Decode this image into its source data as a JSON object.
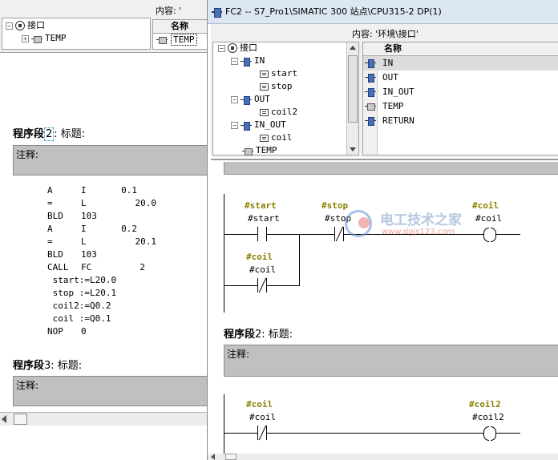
{
  "left_window": {
    "content_label": "内容: '",
    "names_header": "名称",
    "tree": {
      "root": "接口",
      "child": "TEMP"
    },
    "names_rows": [
      "TEMP"
    ],
    "segment2": {
      "label": "程序段",
      "num": "2",
      "suffix": ": 标题:"
    },
    "segment3": {
      "label": "程序段",
      "num": "3",
      "suffix": ": 标题:"
    },
    "comment_label": "注释:",
    "stl_lines": [
      [
        "A",
        "I",
        "0.1"
      ],
      [
        "=",
        "L",
        "20.0"
      ],
      [
        "BLD",
        "103",
        ""
      ],
      [
        "A",
        "I",
        "0.2"
      ],
      [
        "=",
        "L",
        "20.1"
      ],
      [
        "BLD",
        "103",
        ""
      ],
      [
        "CALL",
        "FC",
        "2"
      ],
      [
        " start:=L20.0",
        "",
        ""
      ],
      [
        " stop :=L20.1",
        "",
        ""
      ],
      [
        " coil2:=Q0.2",
        "",
        ""
      ],
      [
        " coil :=Q0.1",
        "",
        ""
      ],
      [
        "NOP",
        "0",
        ""
      ]
    ]
  },
  "right_window": {
    "title": "FC2 -- S7_Pro1\\SIMATIC 300 站点\\CPU315-2 DP(1)",
    "content_label": "内容: '环境\\接口'",
    "names_header": "名称",
    "tree": {
      "root": "接口",
      "in": "IN",
      "in_children": [
        "start",
        "stop"
      ],
      "out": "OUT",
      "out_children": [
        "coil2"
      ],
      "inout": "IN_OUT",
      "inout_children": [
        "coil"
      ],
      "temp": "TEMP"
    },
    "names_rows": [
      "IN",
      "OUT",
      "IN_OUT",
      "TEMP",
      "RETURN"
    ],
    "segment2": {
      "label": "程序段",
      "num": "2",
      "suffix": ": 标题:"
    },
    "comment_label": "注释:",
    "ladder1": {
      "c1_sym": "#start",
      "c1_name": "#start",
      "c2_sym": "#stop",
      "c2_name": "#stop",
      "coil_sym": "#coil",
      "coil_name": "#coil",
      "c3_sym": "#coil",
      "c3_name": "#coil"
    },
    "ladder2": {
      "c1_sym": "#coil",
      "c1_name": "#coil",
      "coil_sym": "#coil2",
      "coil_name": "#coil2"
    }
  },
  "watermark": {
    "main": "电工技术之家",
    "url": "www.dgjs123.com"
  },
  "colors": {
    "symbol": "#8a8000",
    "comment_bg": "#c0c0c0",
    "titlebar": "#dce7f3"
  }
}
